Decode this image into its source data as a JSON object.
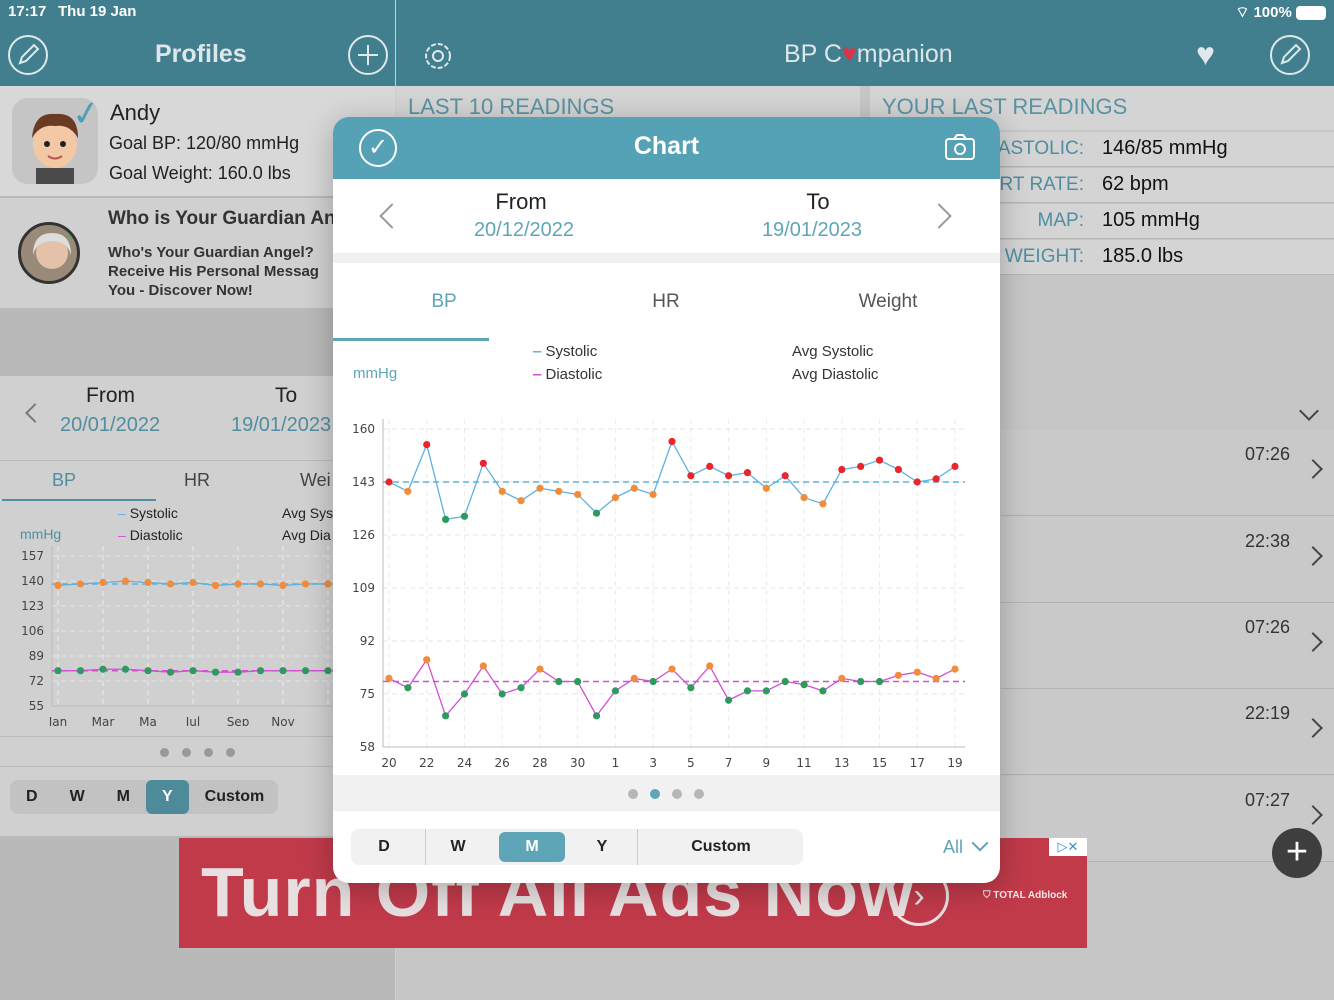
{
  "status_bar": {
    "time": "17:17",
    "date": "Thu 19 Jan",
    "battery": "100%"
  },
  "left_header": {
    "title": "Profiles"
  },
  "right_header": {
    "app_title_prefix": "BP C",
    "app_title_suffix": "mpanion"
  },
  "profile": {
    "name": "Andy",
    "goal_bp": "Goal BP: 120/80 mmHg",
    "goal_weight": "Goal Weight: 160.0 lbs"
  },
  "promo": {
    "title": "Who is Your Guardian An",
    "line1": "Who's Your Guardian Angel?",
    "line2": "Receive His Personal Messag",
    "line3": "You - Discover Now!"
  },
  "left_chart": {
    "from_label": "From",
    "from_value": "20/01/2022",
    "to_label": "To",
    "to_value": "19/01/2023",
    "tabs": [
      "BP",
      "HR",
      "Wei"
    ],
    "legend_systolic": "Systolic",
    "legend_diastolic": "Diastolic",
    "legend_avg_sys": "Avg Sys",
    "legend_avg_dia": "Avg Dia",
    "unit": "mmHg",
    "segments": [
      "D",
      "W",
      "M",
      "Y",
      "Custom"
    ],
    "active_segment": "Y"
  },
  "right_sections": {
    "last10": "LAST 10 READINGS",
    "yourlast": "YOUR LAST READINGS"
  },
  "last_readings": [
    {
      "label": "ASTOLIC:",
      "value": "146/85 mmHg"
    },
    {
      "label": "ART RATE:",
      "value": "62 bpm"
    },
    {
      "label": "MAP:",
      "value": "105 mmHg"
    },
    {
      "label": "WEIGHT:",
      "value": "185.0 lbs"
    }
  ],
  "list_times": [
    "07:26",
    "22:38",
    "07:26",
    "22:19",
    "07:27"
  ],
  "ad": {
    "text": "Turn Off All Ads Now",
    "brand": "TOTAL Adblock"
  },
  "modal": {
    "title": "Chart",
    "from_label": "From",
    "from_value": "20/12/2022",
    "to_label": "To",
    "to_value": "19/01/2023",
    "tabs": [
      "BP",
      "HR",
      "Weight"
    ],
    "active_tab": "BP",
    "unit": "mmHg",
    "legend_systolic": "Systolic",
    "legend_diastolic": "Diastolic",
    "legend_avg_systolic": "Avg Systolic",
    "legend_avg_diastolic": "Avg Diastolic",
    "segments": [
      "D",
      "W",
      "M",
      "Y",
      "Custom"
    ],
    "active_segment": "M",
    "filter": "All",
    "page_count": 4,
    "active_page": 1
  },
  "colors": {
    "header": "#417f8e",
    "accent": "#5ea5b8",
    "systolic_line": "#5db2e0",
    "diastolic_line": "#d24fd6",
    "high_point": "#e8262c",
    "elevated_point": "#f28c3a",
    "normal_point": "#2e9a5e"
  },
  "chart_data": [
    {
      "type": "line",
      "title": "",
      "ylabel": "mmHg",
      "ylim": [
        58,
        160
      ],
      "yticks": [
        58,
        75,
        92,
        109,
        126,
        143,
        160
      ],
      "x": [
        "20",
        "21",
        "22",
        "23",
        "24",
        "25",
        "26",
        "27",
        "28",
        "29",
        "30",
        "31",
        "1",
        "2",
        "3",
        "4",
        "5",
        "6",
        "7",
        "8",
        "9",
        "10",
        "11",
        "12",
        "13",
        "14",
        "15",
        "16",
        "17",
        "18",
        "19"
      ],
      "xtick_labels": [
        "20",
        "22",
        "24",
        "26",
        "28",
        "30",
        "1",
        "3",
        "5",
        "7",
        "9",
        "11",
        "13",
        "15",
        "17",
        "19"
      ],
      "series": [
        {
          "name": "Systolic",
          "values": [
            143,
            140,
            155,
            131,
            132,
            149,
            140,
            137,
            141,
            140,
            139,
            133,
            138,
            141,
            139,
            156,
            145,
            148,
            145,
            146,
            141,
            145,
            138,
            136,
            147,
            148,
            150,
            147,
            143,
            144,
            148
          ]
        },
        {
          "name": "Diastolic",
          "values": [
            80,
            77,
            86,
            68,
            75,
            84,
            75,
            77,
            83,
            79,
            79,
            68,
            76,
            80,
            79,
            83,
            77,
            84,
            73,
            76,
            76,
            79,
            78,
            76,
            80,
            79,
            79,
            81,
            82,
            80,
            83
          ]
        }
      ],
      "avg_systolic": 143,
      "avg_diastolic": 79,
      "grid": true
    },
    {
      "type": "line",
      "title": "",
      "ylabel": "mmHg",
      "ylim": [
        55,
        157
      ],
      "yticks": [
        55,
        72,
        89,
        106,
        123,
        140,
        157
      ],
      "x": [
        "Jan",
        "Feb",
        "Mar",
        "Apr",
        "May",
        "Jun",
        "Jul",
        "Aug",
        "Sep",
        "Oct",
        "Nov",
        "Dec",
        "Jan"
      ],
      "xtick_labels": [
        "Jan",
        "Mar",
        "Ma",
        "Jul",
        "Sep",
        "Nov"
      ],
      "series": [
        {
          "name": "Systolic",
          "values": [
            137,
            138,
            139,
            140,
            139,
            138,
            139,
            137,
            138,
            138,
            137,
            138,
            138
          ]
        },
        {
          "name": "Diastolic",
          "values": [
            79,
            79,
            80,
            80,
            79,
            78,
            79,
            78,
            78,
            79,
            79,
            79,
            79
          ]
        }
      ],
      "avg_systolic": 138,
      "avg_diastolic": 79,
      "grid": true
    }
  ]
}
